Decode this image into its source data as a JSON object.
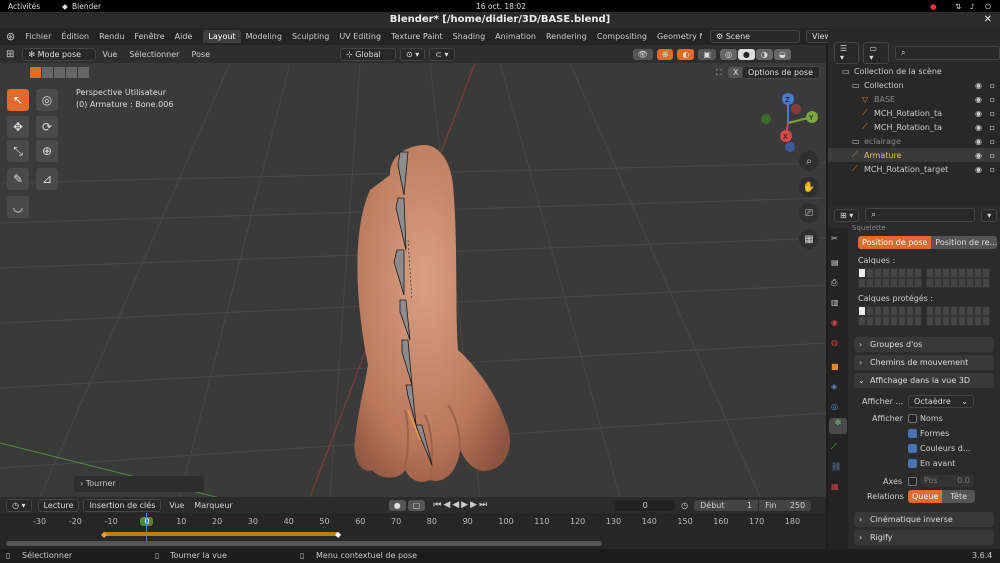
{
  "system": {
    "activities": "Activités",
    "app": "Blender",
    "clock": "16 oct.  18:02"
  },
  "window_title": "Blender* [/home/didier/3D/BASE.blend]",
  "menu": [
    "Fichier",
    "Édition",
    "Rendu",
    "Fenêtre",
    "Aide"
  ],
  "workspaces": [
    "Layout",
    "Modeling",
    "Sculpting",
    "UV Editing",
    "Texture Paint",
    "Shading",
    "Animation",
    "Rendering",
    "Compositing",
    "Geometry N"
  ],
  "scene_label": "Scene",
  "viewlayer_label": "ViewLayer",
  "viewport": {
    "mode": "Mode pose",
    "menus": [
      "Vue",
      "Sélectionner",
      "Pose"
    ],
    "transform": "Global",
    "info_line1": "Perspective Utilisateur",
    "info_line2": "(0) Armature : Bone.006",
    "options": "Options de pose",
    "axis_x": "X",
    "last_op": "Tourner"
  },
  "outliner": {
    "rows": [
      {
        "label": "Collection de la scène",
        "indent": 0,
        "color": "#ccc"
      },
      {
        "label": "Collection",
        "indent": 1,
        "color": "#ccc"
      },
      {
        "label": "BASE",
        "indent": 2,
        "color": "#888"
      },
      {
        "label": "MCH_Rotation_ta",
        "indent": 2,
        "color": "#ccc"
      },
      {
        "label": "MCH_Rotation_ta",
        "indent": 2,
        "color": "#ccc"
      },
      {
        "label": "eclairage",
        "indent": 1,
        "color": "#888"
      },
      {
        "label": "Armature",
        "indent": 1,
        "color": "#e8c04a"
      },
      {
        "label": "MCH_Rotation_target",
        "indent": 1,
        "color": "#ccc"
      }
    ]
  },
  "properties": {
    "top_label": "Squelette",
    "pose_btn": "Position de pose",
    "rest_btn": "Position de re...",
    "calques": "Calques :",
    "calques_proteges": "Calques protégés :",
    "groupes": "Groupes d'os",
    "chemins": "Chemins de mouvement",
    "affichage": "Affichage dans la vue 3D",
    "afficher_en": "Afficher ...",
    "afficher_en_value": "Octaèdre",
    "afficher": "Afficher",
    "opt_noms": "Noms",
    "opt_formes": "Formes",
    "opt_couleurs": "Couleurs d...",
    "opt_avant": "En avant",
    "axes": "Axes",
    "pos_label": "Pos",
    "pos_value": "0.0",
    "relations": "Relations",
    "queue": "Queue",
    "tete": "Tête",
    "cinematique": "Cinématique inverse",
    "rigify": "Rigify"
  },
  "timeline": {
    "lecture": "Lecture",
    "insertion": "Insertion de clés",
    "vue": "Vue",
    "marqueur": "Marqueur",
    "current": "0",
    "debut_label": "Début",
    "debut": "1",
    "fin_label": "Fin",
    "fin": "250",
    "ticks": [
      "-30",
      "-20",
      "-10",
      "0",
      "10",
      "20",
      "30",
      "40",
      "50",
      "60",
      "70",
      "80",
      "90",
      "100",
      "110",
      "120",
      "130",
      "140",
      "150",
      "160",
      "170",
      "180"
    ]
  },
  "status": {
    "select": "Sélectionner",
    "rotate": "Tourner la vue",
    "context": "Menu contextuel de pose",
    "version": "3.6.4"
  }
}
